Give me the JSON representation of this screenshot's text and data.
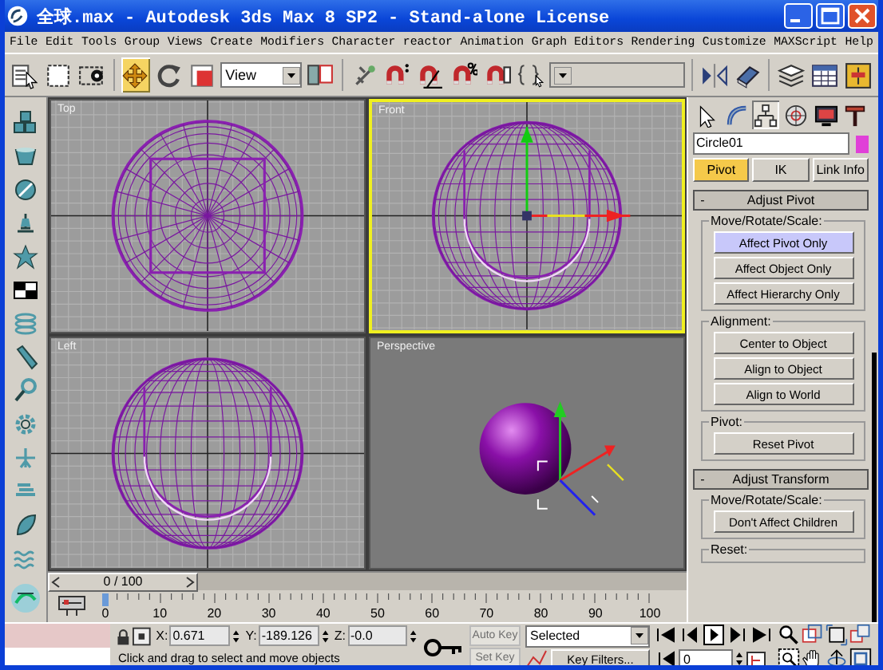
{
  "window": {
    "title": "全球.max - Autodesk 3ds Max 8 SP2  - Stand-alone License"
  },
  "menu": [
    "File",
    "Edit",
    "Tools",
    "Group",
    "Views",
    "Create",
    "Modifiers",
    "Character",
    "reactor",
    "Animation",
    "Graph Editors",
    "Rendering",
    "Customize",
    "MAXScript",
    "Help"
  ],
  "toolbar": [
    {
      "kind": "select-list",
      "selected": false
    },
    {
      "kind": "region",
      "selected": false
    },
    {
      "kind": "window-crossing",
      "selected": false
    },
    {
      "kind": "move",
      "selected": true
    },
    {
      "kind": "rotate",
      "selected": false
    },
    {
      "kind": "scale",
      "selected": false
    },
    {
      "kind": "dropdown",
      "value": "View"
    },
    {
      "kind": "pivot",
      "selected": false
    },
    {
      "kind": "manipulate",
      "selected": false
    },
    {
      "kind": "snap",
      "selected": false
    },
    {
      "kind": "angle-snap",
      "selected": false
    },
    {
      "kind": "percent-snap",
      "selected": false
    },
    {
      "kind": "spinner-snap",
      "selected": false
    },
    {
      "kind": "named-sets",
      "selected": false
    },
    {
      "kind": "dropdown"
    },
    {
      "kind": "mirror",
      "selected": false
    },
    {
      "kind": "align",
      "selected": false
    },
    {
      "kind": "layers",
      "selected": false
    },
    {
      "kind": "curve-editor",
      "selected": false
    },
    {
      "kind": "schematic",
      "selected": false
    }
  ],
  "viewports": [
    {
      "label": "Top",
      "kind": "top",
      "active": false
    },
    {
      "label": "Front",
      "kind": "front",
      "active": true
    },
    {
      "label": "Left",
      "kind": "left",
      "active": false
    },
    {
      "label": "Perspective",
      "kind": "perspective",
      "active": false
    }
  ],
  "command_panel": {
    "tabs": [
      {
        "kind": "create",
        "selected": false
      },
      {
        "kind": "modify",
        "selected": false
      },
      {
        "kind": "hierarchy",
        "selected": true
      },
      {
        "kind": "motion",
        "selected": false
      },
      {
        "kind": "display",
        "selected": false
      },
      {
        "kind": "utilities",
        "selected": false
      }
    ],
    "object_name": "Circle01",
    "subtabs": [
      {
        "label": "Pivot",
        "selected": true
      },
      {
        "label": "IK",
        "selected": false
      },
      {
        "label": "Link Info",
        "selected": false
      }
    ],
    "rollouts": [
      {
        "toggle": "-",
        "title": "Adjust Pivot",
        "groups": [
          {
            "label": "Move/Rotate/Scale:",
            "buttons": [
              {
                "label": "Affect Pivot Only",
                "selected": true
              },
              {
                "label": "Affect Object Only",
                "selected": false
              },
              {
                "label": "Affect Hierarchy Only",
                "selected": false
              }
            ]
          },
          {
            "label": "Alignment:",
            "buttons": [
              {
                "label": "Center to Object",
                "selected": false
              },
              {
                "label": "Align to Object",
                "selected": false
              },
              {
                "label": "Align to World",
                "selected": false
              }
            ]
          },
          {
            "label": "Pivot:",
            "buttons": [
              {
                "label": "Reset Pivot",
                "selected": false
              }
            ]
          }
        ]
      },
      {
        "toggle": "-",
        "title": "Adjust Transform",
        "groups": [
          {
            "label": "Move/Rotate/Scale:",
            "buttons": [
              {
                "label": "Don't Affect Children",
                "selected": false
              }
            ]
          },
          {
            "label": "Reset:"
          }
        ]
      }
    ]
  },
  "time_slider": {
    "position": "0 / 100"
  },
  "track_bar": {
    "ticks": [
      "0",
      "10",
      "20",
      "30",
      "40",
      "50",
      "60",
      "70",
      "80",
      "90",
      "100"
    ]
  },
  "status_bar": {
    "coordinates": [
      {
        "axis": "X:",
        "value": "0.671"
      },
      {
        "axis": "Y:",
        "value": "-189.126"
      },
      {
        "axis": "Z:",
        "value": "-0.0"
      }
    ],
    "prompt": "Click and drag to select and move objects",
    "key_buttons": [
      {
        "label": "Auto Key",
        "disabled": true
      },
      {
        "label": "Set Key",
        "disabled": true
      }
    ],
    "key_mode": "Selected",
    "key_filters": "Key Filters...",
    "frame": "0"
  }
}
